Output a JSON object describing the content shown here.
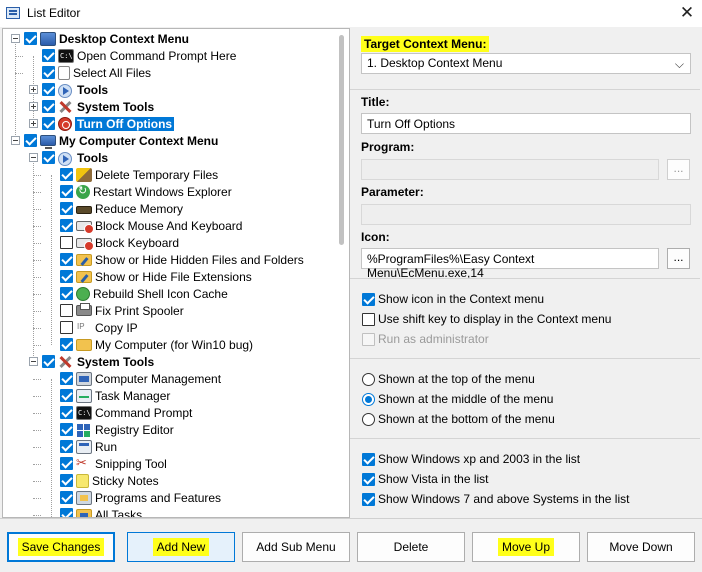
{
  "window": {
    "title": "List Editor",
    "close_glyph": "✕"
  },
  "tree": {
    "nodes": [
      {
        "label": "Desktop Context Menu",
        "checked": true,
        "expander": "minus",
        "icon": "desktop-icon",
        "bold": true
      },
      {
        "label": "Open Command Prompt Here",
        "checked": true,
        "icon": "cmd-icon"
      },
      {
        "label": "Select All Files",
        "checked": true,
        "icon": "page-icon"
      },
      {
        "label": "Tools",
        "checked": true,
        "expander": "plus",
        "icon": "arrow-icon",
        "bold": true
      },
      {
        "label": "System Tools",
        "checked": true,
        "expander": "plus",
        "icon": "tools-icon",
        "bold": true
      },
      {
        "label": "Turn Off Options",
        "checked": true,
        "expander": "plus",
        "icon": "power-icon",
        "bold": true,
        "selected": true
      },
      {
        "label": "My Computer Context Menu",
        "checked": true,
        "expander": "minus",
        "icon": "computer-icon",
        "bold": true
      },
      {
        "label": "Tools",
        "checked": true,
        "expander": "minus",
        "icon": "arrow-icon",
        "bold": true
      },
      {
        "label": "Delete Temporary Files",
        "checked": true,
        "icon": "broom-icon"
      },
      {
        "label": "Restart Windows Explorer",
        "checked": true,
        "icon": "refresh-icon"
      },
      {
        "label": "Reduce Memory",
        "checked": true,
        "icon": "ram-icon"
      },
      {
        "label": "Block Mouse And Keyboard",
        "checked": true,
        "icon": "keyboard-block-icon"
      },
      {
        "label": "Block Keyboard",
        "checked": false,
        "icon": "keyboard-block-icon"
      },
      {
        "label": "Show or Hide Hidden Files and Folders",
        "checked": true,
        "icon": "folder-edit-icon"
      },
      {
        "label": "Show or Hide File Extensions",
        "checked": true,
        "icon": "folder-edit-icon"
      },
      {
        "label": "Rebuild Shell Icon Cache",
        "checked": true,
        "icon": "shell-icon"
      },
      {
        "label": "Fix Print Spooler",
        "checked": false,
        "icon": "printer-icon"
      },
      {
        "label": "Copy IP",
        "checked": false,
        "icon": "ip-icon"
      },
      {
        "label": "My Computer (for Win10 bug)",
        "checked": true,
        "icon": "folder-icon"
      },
      {
        "label": "System Tools",
        "checked": true,
        "expander": "minus",
        "icon": "tools-icon",
        "bold": true
      },
      {
        "label": "Computer Management",
        "checked": true,
        "icon": "management-icon"
      },
      {
        "label": "Task Manager",
        "checked": true,
        "icon": "task-manager-icon"
      },
      {
        "label": "Command Prompt",
        "checked": true,
        "icon": "cmd-icon"
      },
      {
        "label": "Registry Editor",
        "checked": true,
        "icon": "registry-icon"
      },
      {
        "label": "Run",
        "checked": true,
        "icon": "run-icon"
      },
      {
        "label": "Snipping Tool",
        "checked": true,
        "icon": "scissors-icon"
      },
      {
        "label": "Sticky Notes",
        "checked": true,
        "icon": "sticky-note-icon"
      },
      {
        "label": "Programs and Features",
        "checked": true,
        "icon": "programs-icon"
      },
      {
        "label": "All Tasks",
        "checked": true,
        "icon": "all-tasks-icon"
      }
    ]
  },
  "panel": {
    "target_label": "Target Context Menu:",
    "target_value": "1. Desktop Context Menu",
    "title_label": "Title:",
    "title_value": "Turn Off Options",
    "program_label": "Program:",
    "program_value": "",
    "parameter_label": "Parameter:",
    "parameter_value": "",
    "icon_label": "Icon:",
    "icon_value": "%ProgramFiles%\\Easy Context Menu\\EcMenu.exe,14",
    "browse_label": "...",
    "options": {
      "show_icon": {
        "label": "Show icon in the Context menu",
        "checked": true
      },
      "shift_key": {
        "label": "Use shift key to display in the Context menu",
        "checked": false
      },
      "run_admin": {
        "label": "Run as administrator",
        "checked": false,
        "disabled": true
      }
    },
    "position": {
      "top": "Shown at the top of the menu",
      "middle": "Shown at the middle of the menu",
      "bottom": "Shown at the bottom of the menu",
      "selected": "middle"
    },
    "systems": {
      "xp": {
        "label": "Show Windows xp  and 2003 in the list",
        "checked": true
      },
      "vista": {
        "label": "Show Vista in the list",
        "checked": true
      },
      "win7": {
        "label": "Show Windows 7 and above Systems in the list",
        "checked": true
      }
    }
  },
  "buttons": {
    "save": "Save Changes",
    "add_new": "Add New",
    "add_sub": "Add Sub Menu",
    "delete": "Delete",
    "move_up": "Move Up",
    "move_down": "Move Down"
  },
  "colors": {
    "highlight": "#ffff1a",
    "selection": "#0078d7",
    "accent": "#0078d7"
  }
}
